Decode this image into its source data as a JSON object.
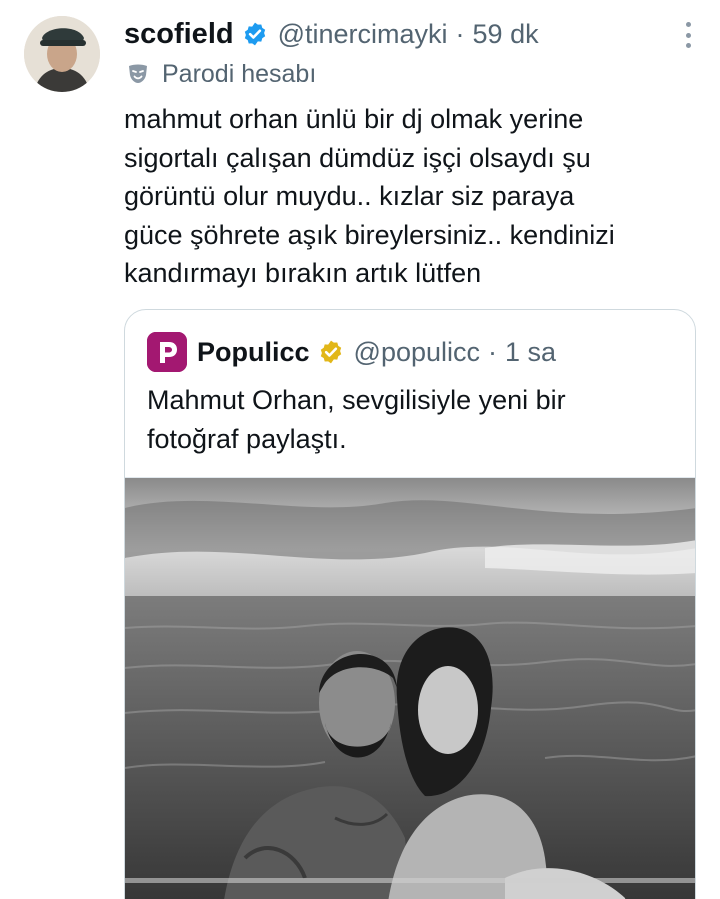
{
  "tweet": {
    "display_name": "scofield",
    "handle": "@tinercimayki",
    "separator": "·",
    "time": "59 dk",
    "parody_label": "Parodi hesabı",
    "text": "mahmut orhan ünlü bir dj olmak yerine\nsigortalı çalışan dümdüz işçi olsaydı şu\ngörüntü olur muydu.. kızlar siz paraya\ngüce şöhrete aşık bireylersiniz.. kendinizi\nkandırmayı bırakın artık lütfen"
  },
  "quoted": {
    "display_name": "Populicc",
    "handle": "@populicc",
    "separator": "·",
    "time": "1 sa",
    "logo_letter": "P",
    "text": "Mahmut Orhan, sevgilisiyle yeni bir\nfotoğraf paylaştı."
  },
  "icons": {
    "verified": "verified-badge-icon",
    "parody": "parody-mask-icon",
    "more": "more-vertical-icon",
    "quoted_verified": "gold-verified-badge-icon"
  },
  "colors": {
    "blue_badge": "#1d9bf0",
    "gold_badge": "#e2b719",
    "brand": "#a31871",
    "secondary_text": "#536471"
  }
}
